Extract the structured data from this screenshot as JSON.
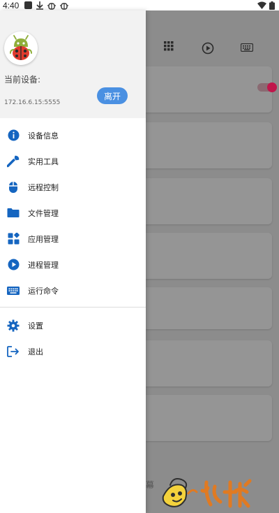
{
  "status_bar": {
    "time": "4:40"
  },
  "header": {
    "current_device_label": "当前设备:",
    "device_ip": "172.16.6.15:5555",
    "leave_button": "离开"
  },
  "menu": {
    "items": [
      {
        "label": "设备信息",
        "icon": "info-icon"
      },
      {
        "label": "实用工具",
        "icon": "wrench-icon"
      },
      {
        "label": "远程控制",
        "icon": "mouse-icon"
      },
      {
        "label": "文件管理",
        "icon": "folder-icon"
      },
      {
        "label": "应用管理",
        "icon": "apps-icon"
      },
      {
        "label": "进程管理",
        "icon": "play-circle-icon"
      },
      {
        "label": "运行命令",
        "icon": "keyboard-icon"
      }
    ],
    "bottom_items": [
      {
        "label": "设置",
        "icon": "gear-icon"
      },
      {
        "label": "退出",
        "icon": "exit-icon"
      }
    ]
  },
  "background": {
    "partial_text": "幕"
  },
  "colors": {
    "accent": "#1565c0",
    "leave_button": "#4a90e2",
    "switch_knob": "#c0164b",
    "scrim": "#8c8c8c"
  }
}
